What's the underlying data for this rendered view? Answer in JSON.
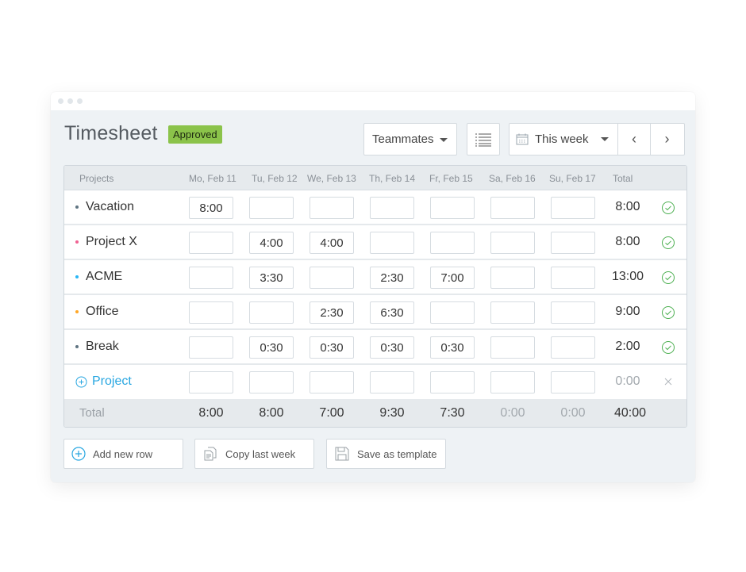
{
  "window": {
    "title": "Timesheet",
    "status_badge": "Approved",
    "badge_color": "#8bc34a"
  },
  "toolbar": {
    "teammates_label": "Teammates",
    "list_view_icon": "list-icon",
    "week_label": "This week",
    "prev_icon": "chevron-left-icon",
    "next_icon": "chevron-right-icon",
    "prev_glyph": "‹",
    "next_glyph": "›"
  },
  "table": {
    "headers": [
      "Projects",
      "Mo, Feb 11",
      "Tu, Feb 12",
      "We, Feb 13",
      "Th, Feb 14",
      "Fr, Feb 15",
      "Sa, Feb 16",
      "Su, Feb 17",
      "Total"
    ],
    "rows": [
      {
        "project": "Vacation",
        "color": "#5f7482",
        "days": [
          "8:00",
          "",
          "",
          "",
          "",
          "",
          ""
        ],
        "total": "8:00",
        "status": "approved"
      },
      {
        "project": "Project X",
        "color": "#f06292",
        "days": [
          "",
          "4:00",
          "4:00",
          "",
          "",
          "",
          ""
        ],
        "total": "8:00",
        "status": "approved"
      },
      {
        "project": "ACME",
        "color": "#29b6f6",
        "days": [
          "",
          "3:30",
          "",
          "2:30",
          "7:00",
          "",
          ""
        ],
        "total": "13:00",
        "status": "approved"
      },
      {
        "project": "Office",
        "color": "#ffa726",
        "days": [
          "",
          "",
          "2:30",
          "6:30",
          "",
          "",
          ""
        ],
        "total": "9:00",
        "status": "approved"
      },
      {
        "project": "Break",
        "color": "#5f7482",
        "days": [
          "",
          "0:30",
          "0:30",
          "0:30",
          "0:30",
          "",
          ""
        ],
        "total": "2:00",
        "status": "approved"
      }
    ],
    "new_row": {
      "label": "Project",
      "days": [
        "",
        "",
        "",
        "",
        "",
        "",
        ""
      ],
      "total": "0:00"
    },
    "footer": {
      "label": "Total",
      "days": [
        "8:00",
        "8:00",
        "7:00",
        "9:30",
        "7:30",
        "0:00",
        "0:00"
      ],
      "total": "40:00"
    }
  },
  "actions": {
    "add_row": "Add new row",
    "copy_last_week": "Copy last week",
    "save_template": "Save as template"
  },
  "colors": {
    "accent": "#29a7e1",
    "approved": "#4caf50"
  }
}
